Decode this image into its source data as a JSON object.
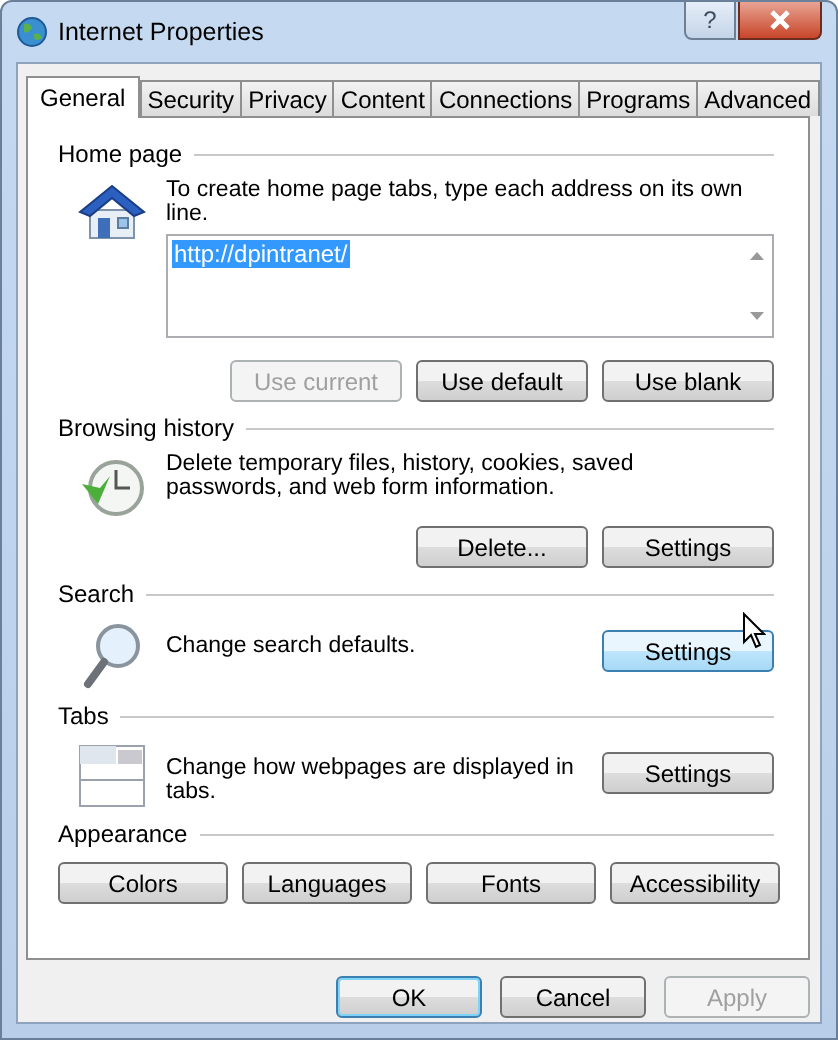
{
  "window": {
    "title": "Internet Properties",
    "help_glyph": "?"
  },
  "tabs": [
    {
      "label": "General",
      "selected": true
    },
    {
      "label": "Security",
      "selected": false
    },
    {
      "label": "Privacy",
      "selected": false
    },
    {
      "label": "Content",
      "selected": false
    },
    {
      "label": "Connections",
      "selected": false
    },
    {
      "label": "Programs",
      "selected": false
    },
    {
      "label": "Advanced",
      "selected": false
    }
  ],
  "sections": [
    {
      "kind": "home",
      "heading": "Home page",
      "description": "To create home page tabs, type each address on its own line.",
      "address": "http://dpintranet/",
      "buttons": [
        {
          "label": "Use current",
          "disabled": true,
          "highlighted": false
        },
        {
          "label": "Use default",
          "disabled": false,
          "highlighted": false
        },
        {
          "label": "Use blank",
          "disabled": false,
          "highlighted": false
        }
      ]
    },
    {
      "kind": "history",
      "heading": "Browsing history",
      "description": "Delete temporary files, history, cookies, saved passwords, and web form information.",
      "buttons": [
        {
          "label": "Delete...",
          "disabled": false,
          "highlighted": false
        },
        {
          "label": "Settings",
          "disabled": false,
          "highlighted": false
        }
      ]
    },
    {
      "kind": "search",
      "heading": "Search",
      "description": "Change search defaults.",
      "buttons": [
        {
          "label": "Settings",
          "disabled": false,
          "highlighted": true
        }
      ]
    },
    {
      "kind": "tabs",
      "heading": "Tabs",
      "description": "Change how webpages are displayed in tabs.",
      "buttons": [
        {
          "label": "Settings",
          "disabled": false,
          "highlighted": false
        }
      ]
    },
    {
      "kind": "appearance",
      "heading": "Appearance",
      "buttons": [
        {
          "label": "Colors",
          "disabled": false,
          "highlighted": false
        },
        {
          "label": "Languages",
          "disabled": false,
          "highlighted": false
        },
        {
          "label": "Fonts",
          "disabled": false,
          "highlighted": false
        },
        {
          "label": "Accessibility",
          "disabled": false,
          "highlighted": false
        }
      ]
    }
  ],
  "footer_buttons": [
    {
      "label": "OK",
      "disabled": false,
      "default": true
    },
    {
      "label": "Cancel",
      "disabled": false,
      "default": false
    },
    {
      "label": "Apply",
      "disabled": true,
      "default": false
    }
  ]
}
